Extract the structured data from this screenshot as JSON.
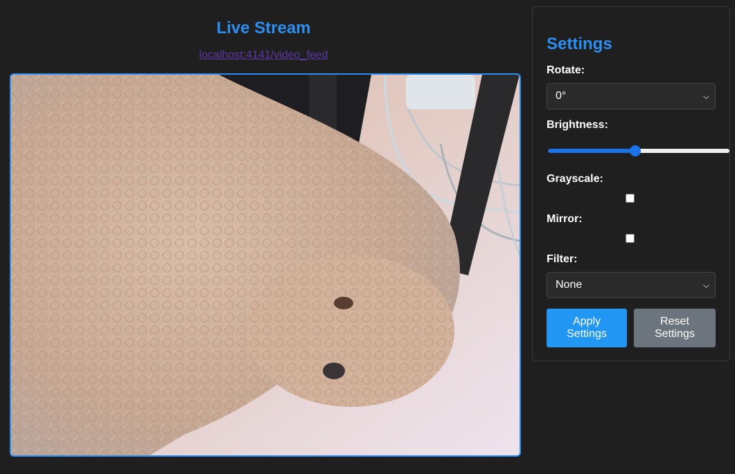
{
  "stream": {
    "title": "Live Stream",
    "feed_link": "localhost:4141/video_feed",
    "accent_color": "#2e8ef0"
  },
  "settings": {
    "title": "Settings",
    "rotate": {
      "label": "Rotate:",
      "value": "0°"
    },
    "brightness": {
      "label": "Brightness:",
      "value_fraction": 0.48
    },
    "grayscale": {
      "label": "Grayscale:",
      "checked": false
    },
    "mirror": {
      "label": "Mirror:",
      "checked": false
    },
    "filter": {
      "label": "Filter:",
      "value": "None"
    },
    "apply_label": "Apply Settings",
    "reset_label": "Reset Settings",
    "apply_color": "#2196f3",
    "reset_color": "#6c757d"
  }
}
